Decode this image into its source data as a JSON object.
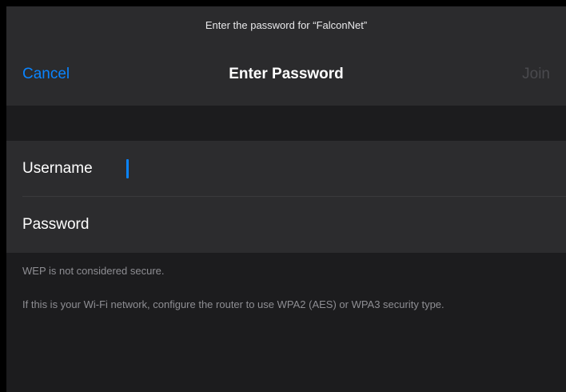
{
  "header": {
    "prompt": "Enter the password for “FalconNet”",
    "title": "Enter Password",
    "cancel_label": "Cancel",
    "join_label": "Join"
  },
  "form": {
    "username_label": "Username",
    "username_value": "",
    "password_label": "Password",
    "password_value": ""
  },
  "footer": {
    "warning": "WEP is not considered secure.",
    "advice": "If this is your Wi-Fi network, configure the router to use WPA2 (AES) or WPA3 security type."
  },
  "colors": {
    "accent": "#0a84ff",
    "disabled": "#4a4a4e",
    "background": "#1c1c1e",
    "field_background": "#2c2c2e"
  }
}
